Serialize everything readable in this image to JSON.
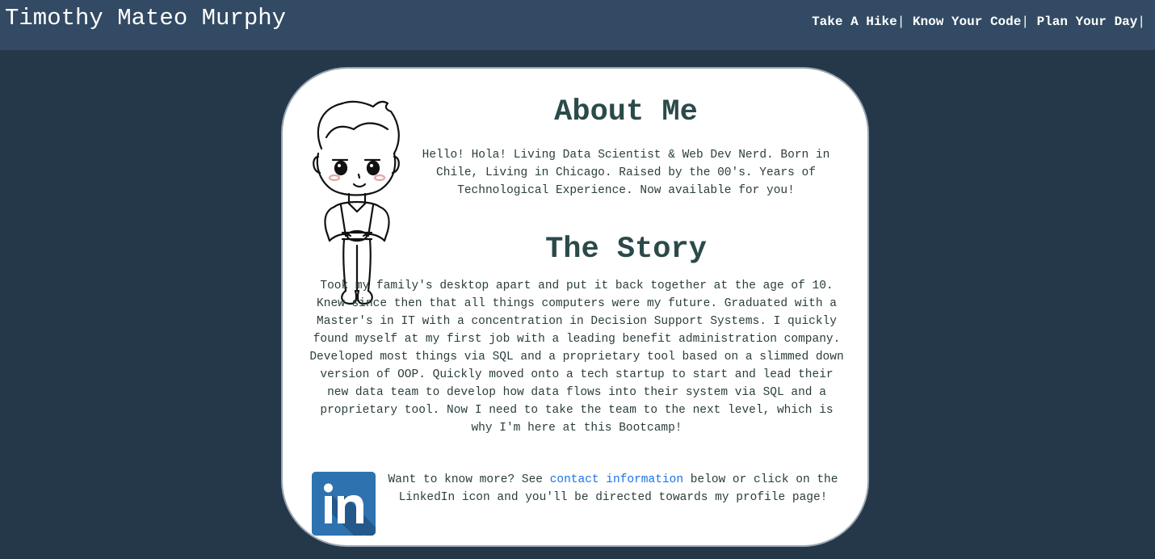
{
  "header": {
    "brand": "Timothy Mateo Murphy",
    "nav": [
      {
        "label": "Take A Hike",
        "sep": "|"
      },
      {
        "label": "Know Your Code",
        "sep": "|"
      },
      {
        "label": "Plan Your Day",
        "sep": "|"
      }
    ]
  },
  "about": {
    "heading": "About Me",
    "text": "Hello! Hola! Living Data Scientist & Web Dev Nerd. Born in Chile, Living in Chicago. Raised by the 00's. Years of Technological Experience. Now available for you!"
  },
  "story": {
    "heading": "The Story",
    "text": "Took my family's desktop apart and put it back together at the age of 10. Knew since then that all things computers were my future. Graduated with a Master's in IT with a concentration in Decision Support Systems. I quickly found myself at my first job with a leading benefit administration company. Developed most things via SQL and a proprietary tool based on a slimmed down version of OOP. Quickly moved onto a tech startup to start and lead their new data team to develop how data flows into their system via SQL and a proprietary tool. Now I need to take the team to the next level, which is why I'm here at this Bootcamp!"
  },
  "contact": {
    "before": "Want to know more? See ",
    "link": "contact information",
    "after": " below or click on the LinkedIn icon and you'll be directed towards my profile page!",
    "icon": "linkedin-icon",
    "icon_text": "in"
  },
  "colors": {
    "background": "#253849",
    "navbar": "#324a63",
    "heading": "#2b4a4a",
    "link": "#1a73e8",
    "linkedin": "#2e73b0"
  }
}
